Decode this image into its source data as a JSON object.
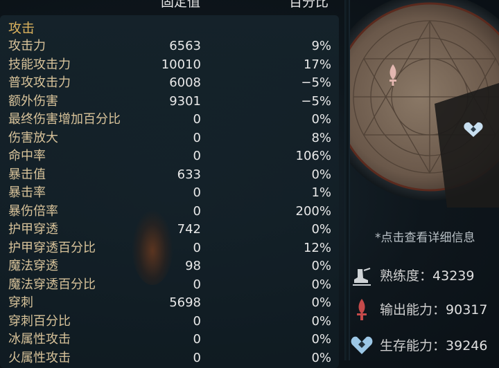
{
  "header": {
    "fixed_label": "固定值",
    "percent_label": "百分比"
  },
  "section": {
    "title": "攻击"
  },
  "stats": [
    {
      "name": "攻击力",
      "value": "6563",
      "percent": "9%"
    },
    {
      "name": "技能攻击力",
      "value": "10010",
      "percent": "17%"
    },
    {
      "name": "普攻攻击力",
      "value": "6008",
      "percent": "−5%"
    },
    {
      "name": "额外伤害",
      "value": "9301",
      "percent": "−5%"
    },
    {
      "name": "最终伤害增加百分比",
      "value": "0",
      "percent": "0%"
    },
    {
      "name": "伤害放大",
      "value": "0",
      "percent": "8%"
    },
    {
      "name": "命中率",
      "value": "0",
      "percent": "106%"
    },
    {
      "name": "暴击值",
      "value": "633",
      "percent": "0%"
    },
    {
      "name": "暴击率",
      "value": "0",
      "percent": "1%"
    },
    {
      "name": "暴伤倍率",
      "value": "0",
      "percent": "200%"
    },
    {
      "name": "护甲穿透",
      "value": "742",
      "percent": "0%"
    },
    {
      "name": "护甲穿透百分比",
      "value": "0",
      "percent": "12%"
    },
    {
      "name": "魔法穿透",
      "value": "98",
      "percent": "0%"
    },
    {
      "name": "魔法穿透百分比",
      "value": "0",
      "percent": "0%"
    },
    {
      "name": "穿刺",
      "value": "5698",
      "percent": "0%"
    },
    {
      "name": "穿刺百分比",
      "value": "0",
      "percent": "0%"
    },
    {
      "name": "冰属性攻击",
      "value": "0",
      "percent": "0%"
    },
    {
      "name": "火属性攻击",
      "value": "0",
      "percent": "0%"
    }
  ],
  "detail": {
    "link_text": "*点击查看详细信息"
  },
  "summary": [
    {
      "label": "熟练度：",
      "value": "43239",
      "icon": "boot-icon"
    },
    {
      "label": "输出能力：",
      "value": "90317",
      "icon": "sword-icon"
    },
    {
      "label": "生存能力：",
      "value": "39246",
      "icon": "heart-icon"
    }
  ],
  "colors": {
    "section_title": "#d9b15d",
    "stat_name": "#d8c39a",
    "icon_red": "#c54a4a",
    "icon_blue": "#9cc7e6"
  }
}
